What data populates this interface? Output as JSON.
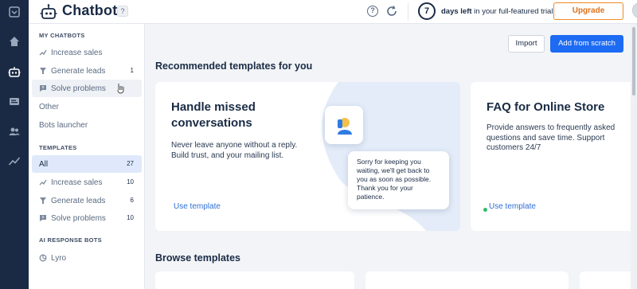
{
  "header": {
    "title": "Chatbots",
    "help_badge": "?",
    "question_icon": "?",
    "trial_days": "7",
    "trial_bold": "days left",
    "trial_rest": " in your full-featured trial",
    "upgrade_label": "Upgrade",
    "status_color": "#2ebc6a"
  },
  "rail": {
    "icons": [
      "inbox-icon",
      "home-icon",
      "chatbot-icon",
      "chat-icon",
      "contacts-icon",
      "analytics-icon"
    ]
  },
  "sidebar": {
    "my_chatbots_heading": "MY CHATBOTS",
    "my_chatbots": [
      {
        "label": "Increase sales",
        "icon": "sales-icon",
        "count": ""
      },
      {
        "label": "Generate leads",
        "icon": "funnel-icon",
        "count": "1"
      },
      {
        "label": "Solve problems",
        "icon": "message-alert-icon",
        "count": ""
      }
    ],
    "other_label": "Other",
    "bots_launcher_label": "Bots launcher",
    "templates_heading": "TEMPLATES",
    "templates": [
      {
        "label": "All",
        "count": "27"
      },
      {
        "label": "Increase sales",
        "count": "10"
      },
      {
        "label": "Generate leads",
        "count": "6"
      },
      {
        "label": "Solve problems",
        "count": "10"
      }
    ],
    "ai_heading": "AI RESPONSE BOTS",
    "lyro_label": "Lyro"
  },
  "main": {
    "import_label": "Import",
    "add_scratch_label": "Add from scratch",
    "recommended_title": "Recommended templates for you",
    "browse_title": "Browse templates",
    "cards": [
      {
        "title_line1": "Handle missed",
        "title_line2": "conversations",
        "desc_line1": "Never leave anyone without a reply.",
        "desc_line2": "Build trust, and your mailing list.",
        "use_label": "Use template",
        "bubble_lines": [
          "Sorry for keeping you",
          "waiting, we'll get back to",
          "you as soon as possible.",
          "Thank you for your",
          "patience."
        ]
      },
      {
        "title_line1": "FAQ for Online Store",
        "desc_line1": "Provide answers to frequently asked",
        "desc_line2": "questions and save time. Support",
        "desc_line3": "customers 24/7",
        "use_label": "Use template"
      }
    ]
  },
  "colors": {
    "rail": "#1b2a44",
    "primary": "#1d6bf3",
    "upgrade": "#f08a24",
    "link": "#2f6fd6",
    "active_item": "#dfe9fb"
  }
}
